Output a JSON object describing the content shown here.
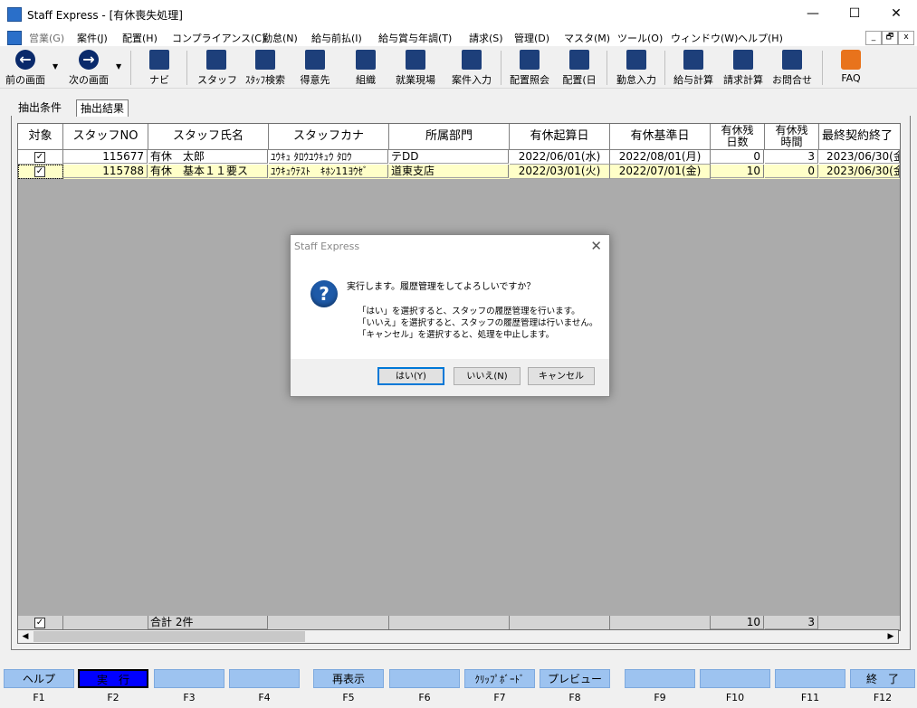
{
  "window": {
    "title": "Staff Express - [有休喪失処理]",
    "minimize": "—",
    "maximize": "☐",
    "close": "✕"
  },
  "menu": [
    {
      "label": "営業(G)",
      "dim": true
    },
    {
      "label": "案件(J)"
    },
    {
      "label": "配置(H)"
    },
    {
      "label": "コンプライアンス(C)"
    },
    {
      "label": "勤怠(N)"
    },
    {
      "label": "給与前払(I)"
    },
    {
      "label": "給与賞与年調(T)"
    },
    {
      "label": "請求(S)"
    },
    {
      "label": "管理(D)"
    },
    {
      "label": "マスタ(M)"
    },
    {
      "label": "ツール(O)"
    },
    {
      "label": "ウィンドウ(W)"
    },
    {
      "label": "ヘルプ(H)"
    }
  ],
  "mdi": {
    "min": "_",
    "restore": "🗗",
    "close": "x"
  },
  "toolbar": {
    "back": "前の画面",
    "forward": "次の画面",
    "navi": "ナビ",
    "staff": "スタッフ",
    "staff_search": "ｽﾀｯﾌ検索",
    "customer": "得意先",
    "org": "組織",
    "site": "就業現場",
    "case_input": "案件入力",
    "assign_query": "配置照会",
    "assign_day": "配置(日",
    "attendance": "勤怠入力",
    "payroll": "給与計算",
    "billing": "請求計算",
    "inquiry": "お問合せ",
    "faq": "FAQ"
  },
  "tabs": {
    "conditions": "抽出条件",
    "results": "抽出結果"
  },
  "grid": {
    "headers": {
      "target": "対象",
      "staff_no": "スタッフNO",
      "name": "スタッフ氏名",
      "kana": "スタッフカナ",
      "dept": "所属部門",
      "start": "有休起算日",
      "base": "有休基準日",
      "days_1": "有休残",
      "days_2": "日数",
      "hours_1": "有休残",
      "hours_2": "時間",
      "last": "最終契約終了"
    },
    "rows": [
      {
        "check": "✓",
        "staff_no": "115677",
        "name": "有休　太郎",
        "kana": "ﾕｳｷｭ ﾀﾛｳﾕｳｷｭｳ ﾀﾛｳ",
        "dept": "テDD",
        "start": "2022/06/01(水)",
        "base": "2022/08/01(月)",
        "days": "0",
        "hours": "3",
        "last": "2023/06/30(金"
      },
      {
        "check": "✓",
        "staff_no": "115788",
        "name": "有休　基本１１要ス",
        "kana": "ﾕｳｷｭｳﾃｽﾄ　ｷﾎﾝ11ﾖｳｾﾞ",
        "dept": "道東支店",
        "start": "2022/03/01(火)",
        "base": "2022/07/01(金)",
        "days": "10",
        "hours": "0",
        "last": "2023/06/30(金"
      }
    ],
    "footer": {
      "check": "✓",
      "total": "合計 2件",
      "days": "10",
      "hours": "3"
    }
  },
  "dialog": {
    "title": "Staff Express",
    "close": "✕",
    "icon": "?",
    "message": "実行します。履歴管理をしてよろしいですか？",
    "line1": "「はい」を選択すると、スタッフの履歴管理を行います。",
    "line2": "「いいえ」を選択すると、スタッフの履歴管理は行いません。",
    "line3": "「キャンセル」を選択すると、処理を中止します。",
    "yes": "はい(Y)",
    "no": "いいえ(N)",
    "cancel": "キャンセル"
  },
  "fkeys": [
    {
      "label": "ヘルプ",
      "key": "F1"
    },
    {
      "label": "実　行",
      "key": "F2",
      "active": true
    },
    {
      "label": "",
      "key": "F3"
    },
    {
      "label": "",
      "key": "F4"
    },
    {
      "label": "再表示",
      "key": "F5"
    },
    {
      "label": "",
      "key": "F6"
    },
    {
      "label": "ｸﾘｯﾌﾟﾎﾞｰﾄﾞ",
      "key": "F7"
    },
    {
      "label": "プレビュー",
      "key": "F8"
    },
    {
      "label": "",
      "key": "F9"
    },
    {
      "label": "",
      "key": "F10"
    },
    {
      "label": "",
      "key": "F11"
    },
    {
      "label": "終　了",
      "key": "F12"
    }
  ]
}
